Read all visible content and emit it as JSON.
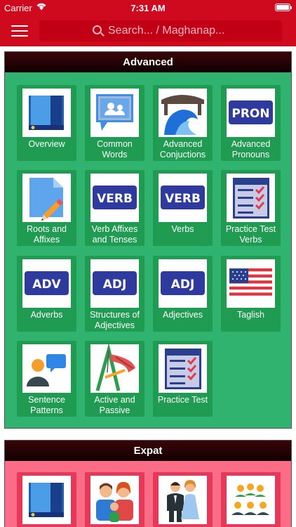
{
  "status_bar": {
    "carrier": "Carrier",
    "time": "7:31 AM"
  },
  "header": {
    "search_placeholder": "Search... / Maghanap..."
  },
  "sections": [
    {
      "title": "Advanced",
      "color": "#2fb36e",
      "items": [
        {
          "label": "Overview",
          "icon": "book-icon"
        },
        {
          "label": "Common Words",
          "icon": "chat-people-icon"
        },
        {
          "label": "Advanced Conjuctions",
          "icon": "bridge-wave-icon"
        },
        {
          "label": "Advanced Pronouns",
          "icon": "pron-badge-icon",
          "badge": "PRON"
        },
        {
          "label": "Roots and Affixes",
          "icon": "document-pencil-icon"
        },
        {
          "label": "Verb Affixes and Tenses",
          "icon": "verb-badge-icon",
          "badge": "VERB"
        },
        {
          "label": "Verbs",
          "icon": "verb-badge-icon",
          "badge": "VERB"
        },
        {
          "label": "Practice Test Verbs",
          "icon": "checklist-icon"
        },
        {
          "label": "Adverbs",
          "icon": "adv-badge-icon",
          "badge": "ADV"
        },
        {
          "label": "Structures of Adjectives",
          "icon": "adj-badge-icon",
          "badge": "ADJ"
        },
        {
          "label": "Adjectives",
          "icon": "adj-badge-icon",
          "badge": "ADJ"
        },
        {
          "label": "Taglish",
          "icon": "us-flag-icon"
        },
        {
          "label": "Sentence Patterns",
          "icon": "person-speech-icon"
        },
        {
          "label": "Active and Passive",
          "icon": "swing-icon"
        },
        {
          "label": "Practice Test",
          "icon": "checklist-icon"
        }
      ]
    },
    {
      "title": "Expat",
      "color": "#fb6d86",
      "items": [
        {
          "icon": "book-icon"
        },
        {
          "icon": "family-icon"
        },
        {
          "icon": "couple-icon"
        },
        {
          "icon": "group-icon"
        }
      ]
    }
  ]
}
